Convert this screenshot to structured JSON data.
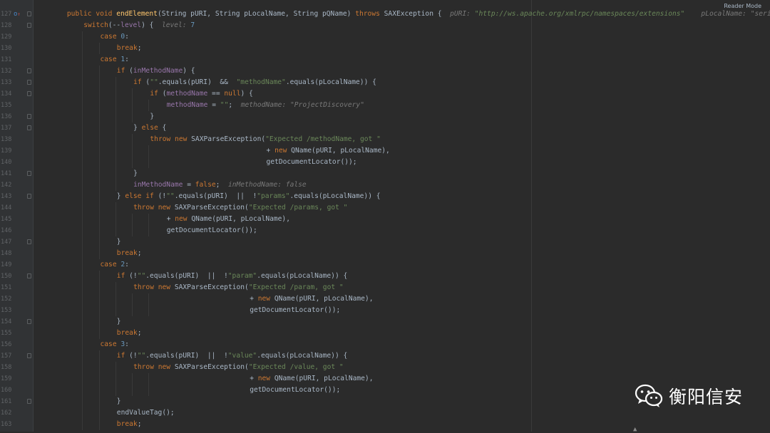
{
  "window": {
    "reader_mode_label": "Reader Mode"
  },
  "watermark": {
    "text": "衡阳信安",
    "icon": "wechat-icon"
  },
  "colors": {
    "background": "#2b2b2b",
    "keyword": "#cc7832",
    "string": "#6a8759",
    "field": "#9876aa",
    "method": "#ffc66d",
    "number": "#6897bb",
    "text": "#a9b7c6"
  },
  "editor": {
    "lines": [
      {
        "num": "127",
        "indent": 3,
        "tokens": [
          [
            "kw",
            "public void "
          ],
          [
            "fn",
            "endElement"
          ],
          [
            "p",
            "(String pURI, String pLocalName, String pQName) "
          ],
          [
            "kw",
            "throws "
          ],
          [
            "p",
            "SAXException {  "
          ],
          [
            "hint",
            "pURI: "
          ],
          [
            "hintv",
            "\"http://ws.apache.org/xmlrpc/namespaces/extensions\"    "
          ],
          [
            "hint",
            "pLocalName: \"serial"
          ]
        ]
      },
      {
        "num": "128",
        "indent": 4,
        "tokens": [
          [
            "kw",
            "switch"
          ],
          [
            "p",
            "(--"
          ],
          [
            "field",
            "level"
          ],
          [
            "p",
            ") {  "
          ],
          [
            "hint",
            "level: "
          ],
          [
            "num",
            "7"
          ]
        ]
      },
      {
        "num": "129",
        "indent": 5,
        "tokens": [
          [
            "kw",
            "case "
          ],
          [
            "num",
            "0"
          ],
          [
            "p",
            ":"
          ]
        ]
      },
      {
        "num": "130",
        "indent": 6,
        "tokens": [
          [
            "kw",
            "break"
          ],
          [
            "p",
            ";"
          ]
        ]
      },
      {
        "num": "131",
        "indent": 5,
        "tokens": [
          [
            "kw",
            "case "
          ],
          [
            "num",
            "1"
          ],
          [
            "p",
            ":"
          ]
        ]
      },
      {
        "num": "132",
        "indent": 6,
        "tokens": [
          [
            "kw",
            "if "
          ],
          [
            "p",
            "("
          ],
          [
            "field",
            "inMethodName"
          ],
          [
            "p",
            ") {"
          ]
        ]
      },
      {
        "num": "133",
        "indent": 7,
        "tokens": [
          [
            "kw",
            "if "
          ],
          [
            "p",
            "("
          ],
          [
            "str",
            "\"\""
          ],
          [
            "p",
            ".equals(pURI)  &&  "
          ],
          [
            "str",
            "\"methodName\""
          ],
          [
            "p",
            ".equals(pLocalName)) {"
          ]
        ]
      },
      {
        "num": "134",
        "indent": 8,
        "tokens": [
          [
            "kw",
            "if "
          ],
          [
            "p",
            "("
          ],
          [
            "field",
            "methodName "
          ],
          [
            "p",
            "== "
          ],
          [
            "kw",
            "null"
          ],
          [
            "p",
            ") {"
          ]
        ]
      },
      {
        "num": "135",
        "indent": 9,
        "tokens": [
          [
            "field",
            "methodName "
          ],
          [
            "p",
            "= "
          ],
          [
            "str",
            "\"\""
          ],
          [
            "p",
            ";  "
          ],
          [
            "hint",
            "methodName: \"ProjectDiscovery\""
          ]
        ]
      },
      {
        "num": "136",
        "indent": 8,
        "tokens": [
          [
            "p",
            "}"
          ]
        ]
      },
      {
        "num": "137",
        "indent": 7,
        "tokens": [
          [
            "p",
            "} "
          ],
          [
            "kw",
            "else "
          ],
          [
            "p",
            "{"
          ]
        ]
      },
      {
        "num": "138",
        "indent": 8,
        "tokens": [
          [
            "kw",
            "throw new "
          ],
          [
            "p",
            "SAXParseException("
          ],
          [
            "str",
            "\"Expected /methodName, got \""
          ]
        ]
      },
      {
        "num": "139",
        "indent": 15,
        "tokens": [
          [
            "p",
            "+ "
          ],
          [
            "kw",
            "new "
          ],
          [
            "p",
            "QName(pURI, pLocalName),"
          ]
        ]
      },
      {
        "num": "140",
        "indent": 15,
        "tokens": [
          [
            "p",
            "getDocumentLocator());"
          ]
        ]
      },
      {
        "num": "141",
        "indent": 7,
        "tokens": [
          [
            "p",
            "}"
          ]
        ]
      },
      {
        "num": "142",
        "indent": 7,
        "tokens": [
          [
            "field",
            "inMethodName "
          ],
          [
            "p",
            "= "
          ],
          [
            "kw",
            "false"
          ],
          [
            "p",
            ";  "
          ],
          [
            "hint",
            "inMethodName: false"
          ]
        ]
      },
      {
        "num": "143",
        "indent": 6,
        "tokens": [
          [
            "p",
            "} "
          ],
          [
            "kw",
            "else if "
          ],
          [
            "p",
            "(!"
          ],
          [
            "str",
            "\"\""
          ],
          [
            "p",
            ".equals(pURI)  ||  !"
          ],
          [
            "str",
            "\"params\""
          ],
          [
            "p",
            ".equals(pLocalName)) {"
          ]
        ]
      },
      {
        "num": "144",
        "indent": 7,
        "tokens": [
          [
            "kw",
            "throw new "
          ],
          [
            "p",
            "SAXParseException("
          ],
          [
            "str",
            "\"Expected /params, got \""
          ]
        ]
      },
      {
        "num": "145",
        "indent": 9,
        "tokens": [
          [
            "p",
            "+ "
          ],
          [
            "kw",
            "new "
          ],
          [
            "p",
            "QName(pURI, pLocalName),"
          ]
        ]
      },
      {
        "num": "146",
        "indent": 9,
        "tokens": [
          [
            "p",
            "getDocumentLocator());"
          ]
        ]
      },
      {
        "num": "147",
        "indent": 6,
        "tokens": [
          [
            "p",
            "}"
          ]
        ]
      },
      {
        "num": "148",
        "indent": 6,
        "tokens": [
          [
            "kw",
            "break"
          ],
          [
            "p",
            ";"
          ]
        ]
      },
      {
        "num": "149",
        "indent": 5,
        "tokens": [
          [
            "kw",
            "case "
          ],
          [
            "num",
            "2"
          ],
          [
            "p",
            ":"
          ]
        ]
      },
      {
        "num": "150",
        "indent": 6,
        "tokens": [
          [
            "kw",
            "if "
          ],
          [
            "p",
            "(!"
          ],
          [
            "str",
            "\"\""
          ],
          [
            "p",
            ".equals(pURI)  ||  !"
          ],
          [
            "str",
            "\"param\""
          ],
          [
            "p",
            ".equals(pLocalName)) {"
          ]
        ]
      },
      {
        "num": "151",
        "indent": 7,
        "tokens": [
          [
            "kw",
            "throw new "
          ],
          [
            "p",
            "SAXParseException("
          ],
          [
            "str",
            "\"Expected /param, got \""
          ]
        ]
      },
      {
        "num": "152",
        "indent": 14,
        "tokens": [
          [
            "p",
            "+ "
          ],
          [
            "kw",
            "new "
          ],
          [
            "p",
            "QName(pURI, pLocalName),"
          ]
        ]
      },
      {
        "num": "153",
        "indent": 14,
        "tokens": [
          [
            "p",
            "getDocumentLocator());"
          ]
        ]
      },
      {
        "num": "154",
        "indent": 6,
        "tokens": [
          [
            "p",
            "}"
          ]
        ]
      },
      {
        "num": "155",
        "indent": 6,
        "tokens": [
          [
            "kw",
            "break"
          ],
          [
            "p",
            ";"
          ]
        ]
      },
      {
        "num": "156",
        "indent": 5,
        "tokens": [
          [
            "kw",
            "case "
          ],
          [
            "num",
            "3"
          ],
          [
            "p",
            ":"
          ]
        ]
      },
      {
        "num": "157",
        "indent": 6,
        "tokens": [
          [
            "kw",
            "if "
          ],
          [
            "p",
            "(!"
          ],
          [
            "str",
            "\"\""
          ],
          [
            "p",
            ".equals(pURI)  ||  !"
          ],
          [
            "str",
            "\"value\""
          ],
          [
            "p",
            ".equals(pLocalName)) {"
          ]
        ]
      },
      {
        "num": "158",
        "indent": 7,
        "tokens": [
          [
            "kw",
            "throw new "
          ],
          [
            "p",
            "SAXParseException("
          ],
          [
            "str",
            "\"Expected /value, got \""
          ]
        ]
      },
      {
        "num": "159",
        "indent": 14,
        "tokens": [
          [
            "p",
            "+ "
          ],
          [
            "kw",
            "new "
          ],
          [
            "p",
            "QName(pURI, pLocalName),"
          ]
        ]
      },
      {
        "num": "160",
        "indent": 14,
        "tokens": [
          [
            "p",
            "getDocumentLocator());"
          ]
        ]
      },
      {
        "num": "161",
        "indent": 6,
        "tokens": [
          [
            "p",
            "}"
          ]
        ]
      },
      {
        "num": "162",
        "indent": 6,
        "tokens": [
          [
            "p",
            "endValueTag();"
          ]
        ]
      },
      {
        "num": "163",
        "indent": 6,
        "tokens": [
          [
            "kw",
            "break"
          ],
          [
            "p",
            ";"
          ]
        ]
      }
    ]
  }
}
